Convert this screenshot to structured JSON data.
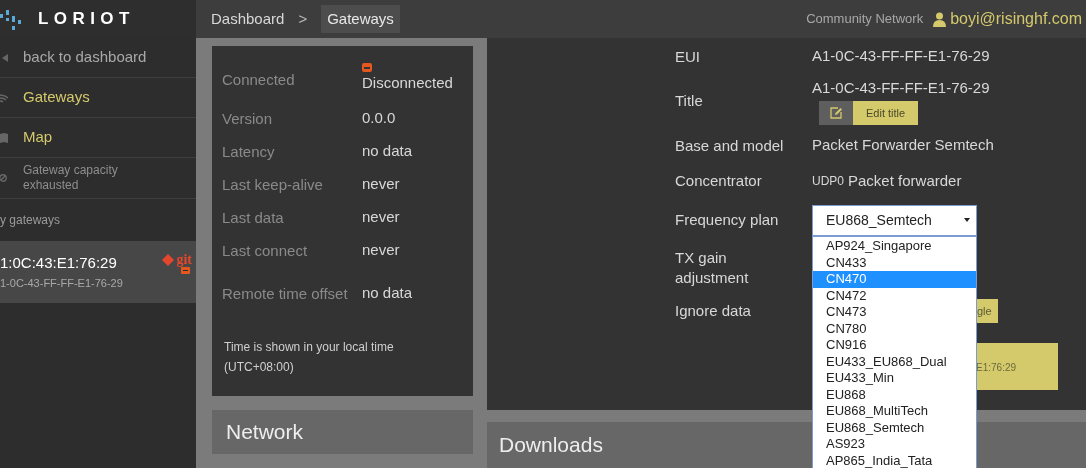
{
  "logo": {
    "text": "LORIOT"
  },
  "breadcrumb": [
    {
      "label": "Dashboard",
      "selected": false
    },
    {
      "label": "Gateways",
      "selected": true
    }
  ],
  "breadcrumb_separator": ">",
  "network_label": "Community Network",
  "user": "boyi@risinghf.com",
  "sidebar": {
    "items": [
      {
        "kind": "back",
        "label": "back to dashboard"
      },
      {
        "kind": "link",
        "label": "Gateways"
      },
      {
        "kind": "link",
        "label": "Map"
      },
      {
        "kind": "notice",
        "label": "Gateway capacity exhausted"
      }
    ],
    "section_label": "y gateways",
    "gateways": [
      {
        "name": "1:0C:43:E1:76:29",
        "eui": "1-0C-43-FF-FF-E1-76-29",
        "badge": "git",
        "connected": false,
        "selected": true
      }
    ]
  },
  "status_panel": {
    "rows": [
      {
        "label": "Connected",
        "value": "Disconnected",
        "connected": false
      },
      {
        "label": "Version",
        "value": "0.0.0"
      },
      {
        "label": "Latency",
        "value": "no data"
      },
      {
        "label": "Last keep-alive",
        "value": "never"
      },
      {
        "label": "Last data",
        "value": "never"
      },
      {
        "label": "Last connect",
        "value": "never"
      },
      {
        "label": "Remote time offset",
        "value": "no data"
      }
    ],
    "note": "Time is shown in your local time (UTC+08:00)"
  },
  "network_panel": {
    "title": "Network"
  },
  "details": {
    "rows": [
      {
        "kind": "text",
        "label": "EUI",
        "value": "A1-0C-43-FF-FF-E1-76-29"
      },
      {
        "kind": "title",
        "label": "Title",
        "value": "A1-0C-43-FF-FF-E1-76-29",
        "button": "Edit title"
      },
      {
        "kind": "text",
        "label": "Base and model",
        "value": "Packet Forwarder Semtech"
      },
      {
        "kind": "prefixed",
        "label": "Concentrator",
        "prefix": "UDP0",
        "value": "Packet forwarder"
      },
      {
        "kind": "select",
        "label": "Frequency plan",
        "value": "EU868_Semtech"
      },
      {
        "kind": "label",
        "label": "TX gain adjustment"
      },
      {
        "kind": "toggle",
        "label": "Ignore data",
        "button": "gle"
      }
    ],
    "card": {
      "text": "E1:76:29"
    }
  },
  "dropdown": {
    "options": [
      {
        "label": "AP924_Singapore",
        "selected": false
      },
      {
        "label": "CN433",
        "selected": false
      },
      {
        "label": "CN470",
        "selected": true
      },
      {
        "label": "CN472",
        "selected": false
      },
      {
        "label": "CN473",
        "selected": false
      },
      {
        "label": "CN780",
        "selected": false
      },
      {
        "label": "CN916",
        "selected": false
      },
      {
        "label": "EU433_EU868_Dual",
        "selected": false
      },
      {
        "label": "EU433_Min",
        "selected": false
      },
      {
        "label": "EU868",
        "selected": false
      },
      {
        "label": "EU868_MultiTech",
        "selected": false
      },
      {
        "label": "EU868_Semtech",
        "selected": false
      },
      {
        "label": "AS923",
        "selected": false
      },
      {
        "label": "AP865_India_Tata",
        "selected": false
      }
    ]
  },
  "downloads": {
    "title": "Downloads"
  }
}
